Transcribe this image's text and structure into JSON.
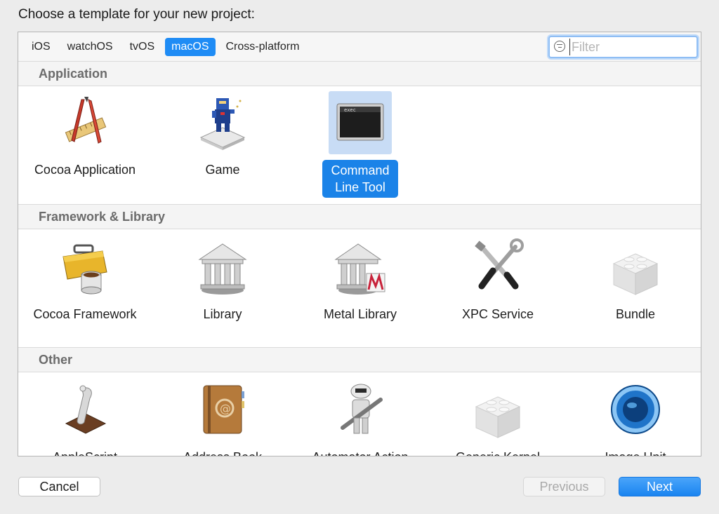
{
  "dialog": {
    "heading": "Choose a template for your new project:"
  },
  "platform_tabs": [
    {
      "label": "iOS",
      "active": false
    },
    {
      "label": "watchOS",
      "active": false
    },
    {
      "label": "tvOS",
      "active": false
    },
    {
      "label": "macOS",
      "active": true
    },
    {
      "label": "Cross-platform",
      "active": false
    }
  ],
  "filter": {
    "placeholder": "Filter",
    "value": ""
  },
  "sections": [
    {
      "title": "Application",
      "items": [
        {
          "label": "Cocoa Application",
          "icon": "cocoa-app-icon",
          "selected": false
        },
        {
          "label": "Game",
          "icon": "game-icon",
          "selected": false
        },
        {
          "label": "Command",
          "label2": "Line Tool",
          "icon": "terminal-icon",
          "selected": true
        }
      ]
    },
    {
      "title": "Framework & Library",
      "items": [
        {
          "label": "Cocoa Framework",
          "icon": "toolbox-icon"
        },
        {
          "label": "Library",
          "icon": "library-building-icon"
        },
        {
          "label": "Metal Library",
          "icon": "metal-library-icon"
        },
        {
          "label": "XPC Service",
          "icon": "tools-icon"
        },
        {
          "label": "Bundle",
          "icon": "lego-brick-icon"
        }
      ]
    },
    {
      "title": "Other",
      "items": [
        {
          "label": "AppleScript",
          "icon": "script-scroll-icon"
        },
        {
          "label": "Address Book",
          "icon": "address-book-icon"
        },
        {
          "label": "Automator Action",
          "icon": "automator-robot-icon"
        },
        {
          "label": "Generic Kernel",
          "icon": "lego-brick-icon"
        },
        {
          "label": "Image Unit",
          "icon": "aperture-icon"
        }
      ]
    }
  ],
  "buttons": {
    "cancel": "Cancel",
    "previous": "Previous",
    "next": "Next"
  },
  "colors": {
    "accent": "#1f8cf5",
    "selection_bg": "#c8dcf5"
  }
}
